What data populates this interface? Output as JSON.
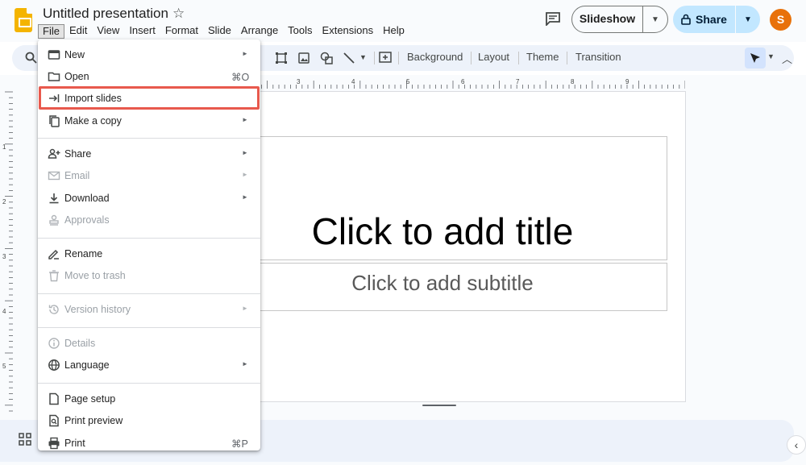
{
  "app": {
    "title": "Untitled presentation"
  },
  "menubar": {
    "items": [
      "File",
      "Edit",
      "View",
      "Insert",
      "Format",
      "Slide",
      "Arrange",
      "Tools",
      "Extensions",
      "Help"
    ]
  },
  "header": {
    "slideshow_label": "Slideshow",
    "share_label": "Share",
    "avatar_initial": "S"
  },
  "toolbar": {
    "background_label": "Background",
    "layout_label": "Layout",
    "theme_label": "Theme",
    "transition_label": "Transition"
  },
  "ruler": {
    "h_ticks": [
      "3",
      "4",
      "5",
      "6",
      "7",
      "8",
      "9"
    ],
    "v_ticks": [
      "1",
      "2",
      "3",
      "4",
      "5"
    ]
  },
  "slide": {
    "title_placeholder": "Click to add title",
    "subtitle_placeholder": "Click to add subtitle"
  },
  "file_menu": {
    "items": [
      {
        "label": "New",
        "icon": "new-slides-icon",
        "submenu": true,
        "disabled": false
      },
      {
        "label": "Open",
        "icon": "folder-icon",
        "shortcut": "⌘O",
        "disabled": false
      },
      {
        "label": "Import slides",
        "icon": "import-icon",
        "disabled": false,
        "highlighted": true
      },
      {
        "label": "Make a copy",
        "icon": "copy-icon",
        "submenu": true,
        "disabled": false
      },
      {
        "label": "Share",
        "icon": "person-add-icon",
        "submenu": true,
        "disabled": false
      },
      {
        "label": "Email",
        "icon": "email-icon",
        "submenu": true,
        "disabled": true
      },
      {
        "label": "Download",
        "icon": "download-icon",
        "submenu": true,
        "disabled": false
      },
      {
        "label": "Approvals",
        "icon": "approvals-icon",
        "disabled": true
      },
      {
        "label": "Rename",
        "icon": "rename-icon",
        "disabled": false
      },
      {
        "label": "Move to trash",
        "icon": "trash-icon",
        "disabled": true
      },
      {
        "label": "Version history",
        "icon": "history-icon",
        "submenu": true,
        "disabled": true
      },
      {
        "label": "Details",
        "icon": "info-icon",
        "disabled": true
      },
      {
        "label": "Language",
        "icon": "globe-icon",
        "submenu": true,
        "disabled": false
      },
      {
        "label": "Page setup",
        "icon": "page-setup-icon",
        "disabled": false
      },
      {
        "label": "Print preview",
        "icon": "print-preview-icon",
        "disabled": false
      },
      {
        "label": "Print",
        "icon": "print-icon",
        "shortcut": "⌘P",
        "disabled": false
      }
    ]
  },
  "colors": {
    "highlight_border": "#e8594d",
    "share_bg": "#c2e7ff",
    "avatar_bg": "#e8710a",
    "logo": "#f4b400"
  }
}
